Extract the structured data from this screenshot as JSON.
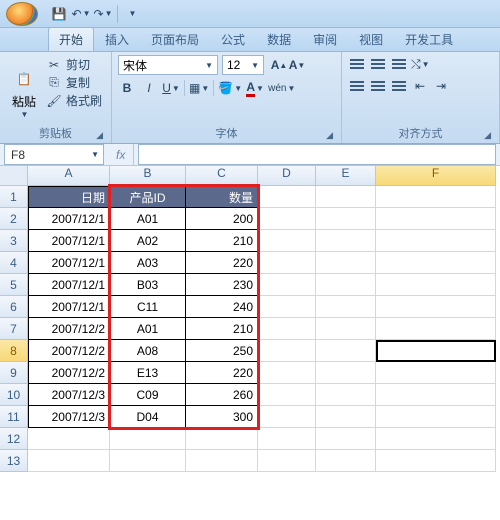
{
  "qat": {
    "save": "💾",
    "undo": "↶",
    "redo": "↷"
  },
  "tabs": [
    "开始",
    "插入",
    "页面布局",
    "公式",
    "数据",
    "审阅",
    "视图",
    "开发工具"
  ],
  "activeTab": 0,
  "clipboard": {
    "cut": "剪切",
    "copy": "复制",
    "format_painter": "格式刷",
    "paste": "粘贴",
    "group_label": "剪贴板"
  },
  "font": {
    "name": "宋体",
    "size": "12",
    "bold": "B",
    "italic": "I",
    "underline": "U",
    "group_label": "字体"
  },
  "align": {
    "group_label": "对齐方式"
  },
  "namebox": "F8",
  "fx_label": "fx",
  "columns": [
    "A",
    "B",
    "C",
    "D",
    "E",
    "F"
  ],
  "headers": {
    "c1": "日期",
    "c2": "产品ID",
    "c3": "数量"
  },
  "rows": [
    {
      "n": 1,
      "a": "",
      "b": "",
      "c": ""
    },
    {
      "n": 2,
      "a": "2007/12/1",
      "b": "A01",
      "c": "200"
    },
    {
      "n": 3,
      "a": "2007/12/1",
      "b": "A02",
      "c": "210"
    },
    {
      "n": 4,
      "a": "2007/12/1",
      "b": "A03",
      "c": "220"
    },
    {
      "n": 5,
      "a": "2007/12/1",
      "b": "B03",
      "c": "230"
    },
    {
      "n": 6,
      "a": "2007/12/1",
      "b": "C11",
      "c": "240"
    },
    {
      "n": 7,
      "a": "2007/12/2",
      "b": "A01",
      "c": "210"
    },
    {
      "n": 8,
      "a": "2007/12/2",
      "b": "A08",
      "c": "250"
    },
    {
      "n": 9,
      "a": "2007/12/2",
      "b": "E13",
      "c": "220"
    },
    {
      "n": 10,
      "a": "2007/12/3",
      "b": "C09",
      "c": "260"
    },
    {
      "n": 11,
      "a": "2007/12/3",
      "b": "D04",
      "c": "300"
    },
    {
      "n": 12,
      "a": "",
      "b": "",
      "c": ""
    },
    {
      "n": 13,
      "a": "",
      "b": "",
      "c": ""
    }
  ],
  "active_cell": "F8"
}
